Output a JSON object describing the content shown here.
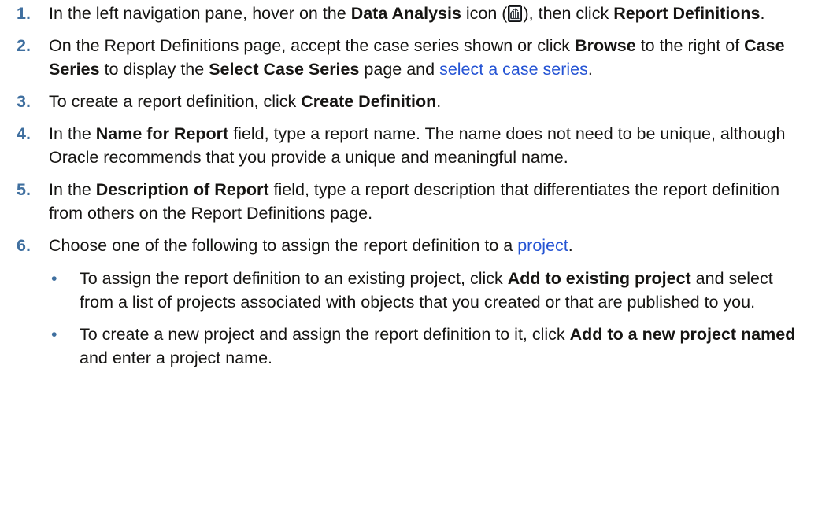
{
  "steps": [
    {
      "num": "1.",
      "s1": "In the left navigation pane, hover on the ",
      "b1": "Data Analysis",
      "s2": " icon (",
      "icon": "data-analysis-icon",
      "s3": "), then click ",
      "b2": "Report Definitions",
      "s4": "."
    },
    {
      "num": "2.",
      "s1": "On the Report Definitions page, accept the case series shown or click ",
      "b1": "Browse",
      "s2": " to the right of ",
      "b2": "Case Series",
      "s3": " to display the ",
      "b3": "Select Case Series",
      "s4": " page and ",
      "link": "select a case series",
      "s5": "."
    },
    {
      "num": "3.",
      "s1": "To create a report definition, click ",
      "b1": "Create Definition",
      "s2": "."
    },
    {
      "num": "4.",
      "s1": "In the ",
      "b1": "Name for Report",
      "s2": " field, type a report name. The name does not need to be unique, although Oracle recommends that you provide a unique and meaningful name."
    },
    {
      "num": "5.",
      "s1": "In the ",
      "b1": "Description of Report",
      "s2": " field, type a report description that differentiates the report definition from others on the Report Definitions page."
    },
    {
      "num": "6.",
      "s1": "Choose one of the following to assign the report definition to a ",
      "link": "project",
      "s2": ".",
      "bullets": [
        {
          "marker": "•",
          "s1": "To assign the report definition to an existing project, click ",
          "b1": "Add to existing project",
          "s2": " and select from a list of projects associated with objects that you created or that are published to you."
        },
        {
          "marker": "•",
          "s1": "To create a new project and assign the report definition to it, click ",
          "b1": "Add to a new project named",
          "s2": " and enter a project name."
        }
      ]
    }
  ],
  "colors": {
    "number": "#3f6f9f",
    "link": "#2554d4",
    "text": "#161513"
  }
}
